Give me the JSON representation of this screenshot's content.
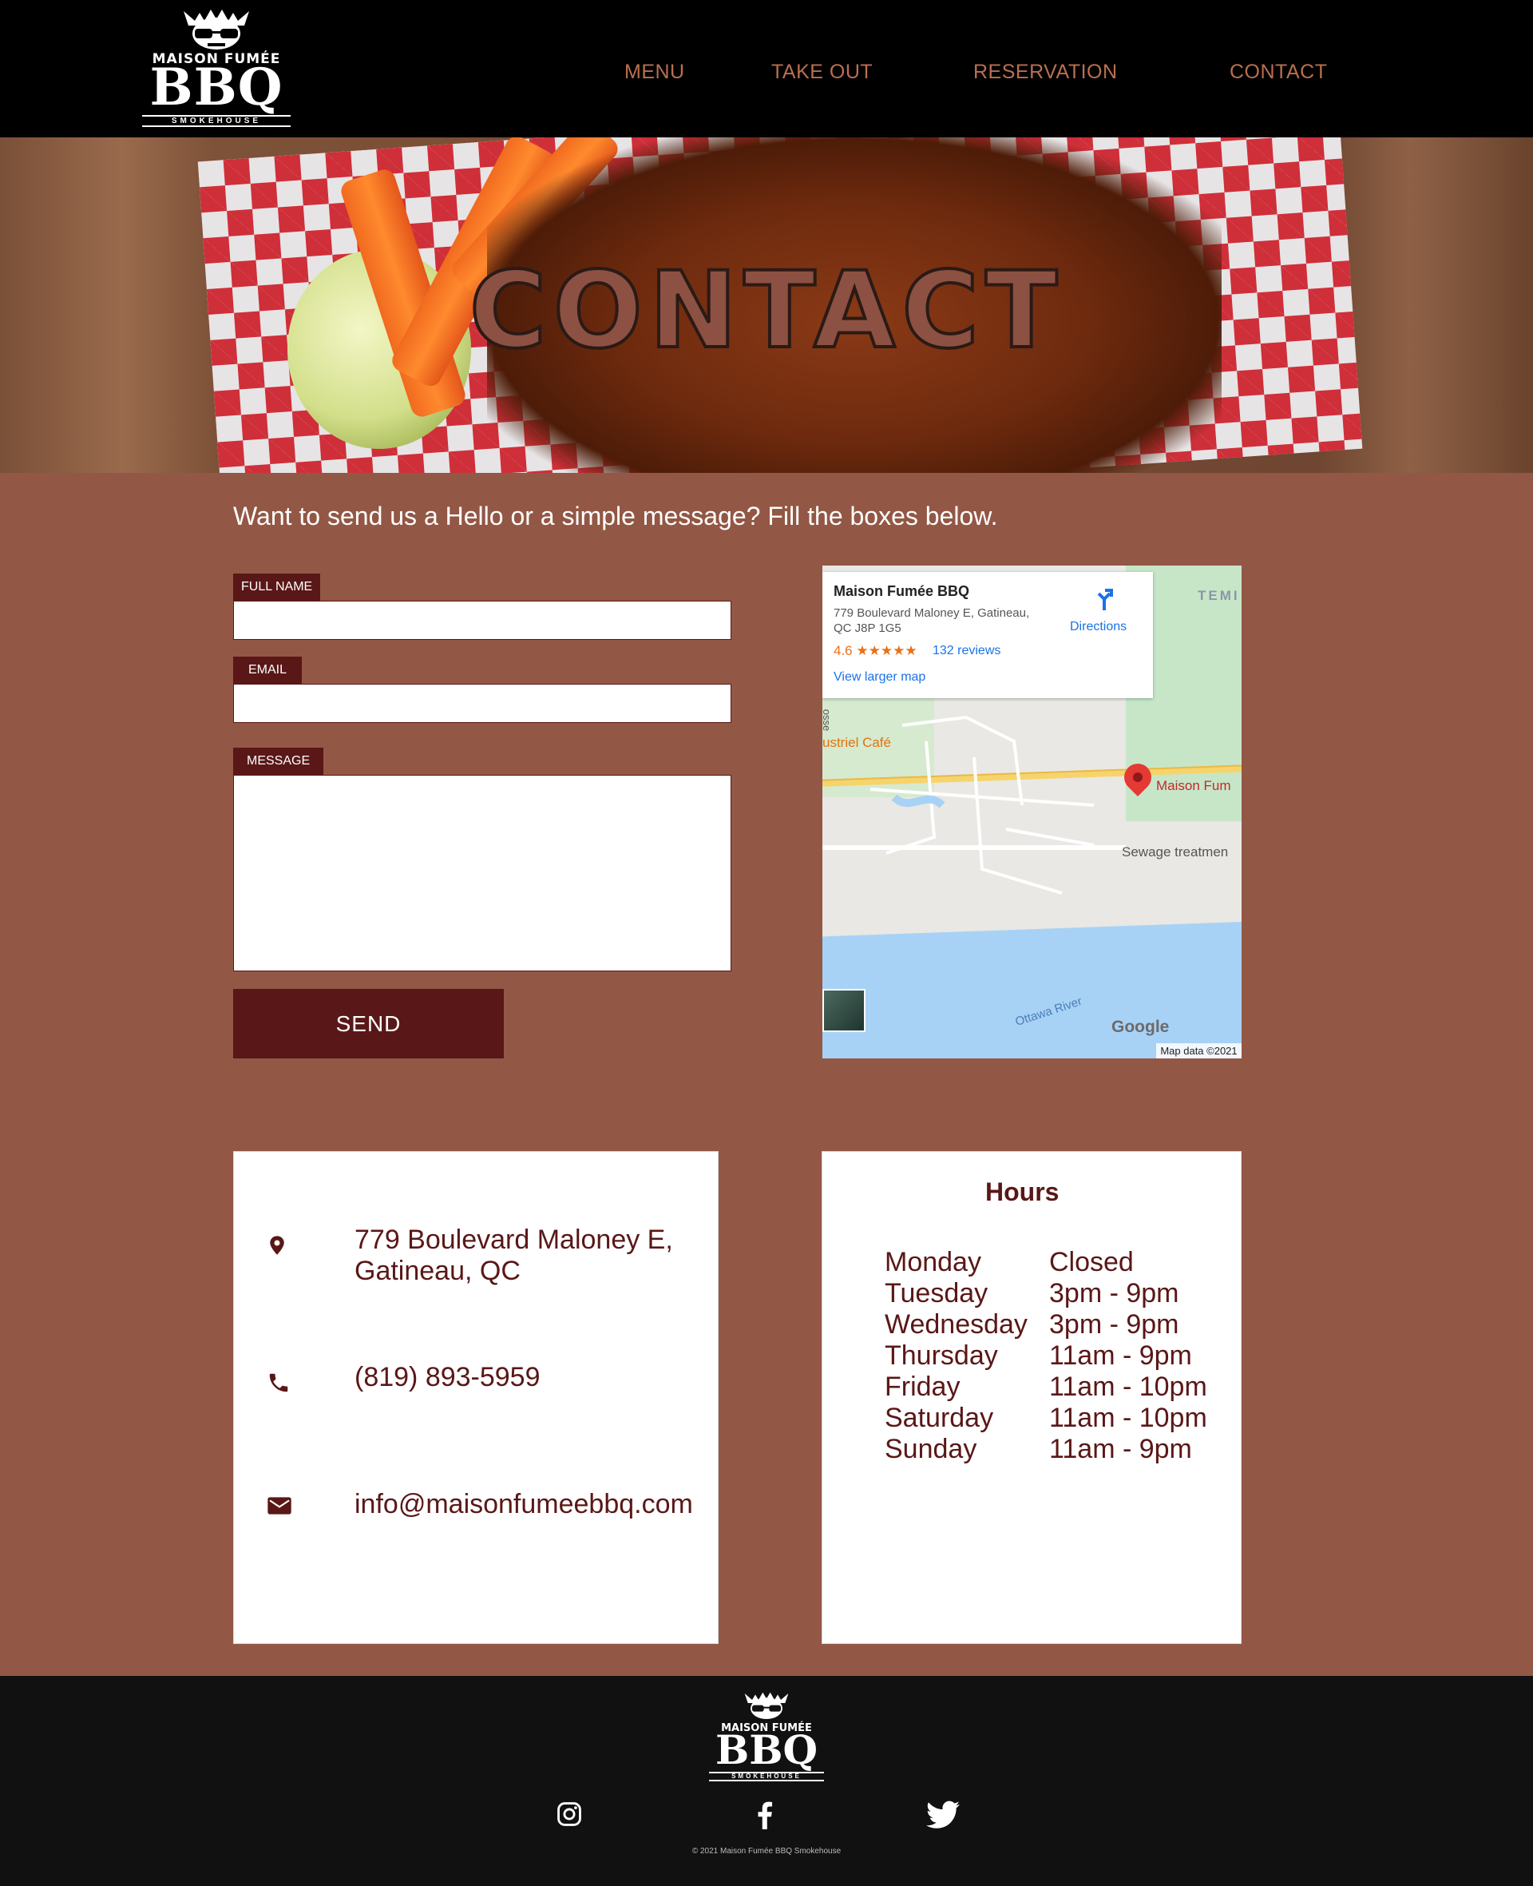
{
  "header": {
    "logo": {
      "line1": "MAISON FUMÉE",
      "line2": "BBQ",
      "line3": "SMOKEHOUSE",
      "icon": "skull-sunglasses-logo"
    },
    "nav": [
      {
        "label": "MENU"
      },
      {
        "label": "TAKE OUT"
      },
      {
        "label": "RESERVATION"
      },
      {
        "label": "CONTACT"
      }
    ]
  },
  "hero": {
    "title": "CONTACT"
  },
  "intro": "Want to send us a Hello or a simple message? Fill the boxes below.",
  "form": {
    "full_name_label": "FULL NAME",
    "full_name_value": "",
    "email_label": "EMAIL",
    "email_value": "",
    "message_label": "MESSAGE",
    "message_value": "",
    "send_label": "SEND"
  },
  "map": {
    "place_name": "Maison Fumée BBQ",
    "address": "779 Boulevard Maloney E, Gatineau, QC J8P 1G5",
    "rating": "4.6 ★★★★★",
    "reviews": "132 reviews",
    "larger_map": "View larger map",
    "directions": "Directions",
    "labels": {
      "temp": "TEMI",
      "cafe": "ustriel Café",
      "marker": "Maison Fum",
      "sewage": "Sewage treatmen",
      "river": "Ottawa River",
      "grosse": "osse"
    },
    "google": "Google",
    "attribution": "Map data ©2021"
  },
  "contact_info": {
    "address_line1": "779 Boulevard Maloney E,",
    "address_line2": "Gatineau, QC",
    "phone": "(819) 893-5959",
    "email": "info@maisonfumeebbq.com"
  },
  "hours": {
    "title": "Hours",
    "rows": [
      {
        "day": "Monday",
        "time": "Closed"
      },
      {
        "day": "Tuesday",
        "time": "3pm - 9pm"
      },
      {
        "day": "Wednesday",
        "time": "3pm - 9pm"
      },
      {
        "day": "Thursday",
        "time": "11am - 9pm"
      },
      {
        "day": "Friday",
        "time": "11am - 10pm"
      },
      {
        "day": "Saturday",
        "time": "11am - 10pm"
      },
      {
        "day": "Sunday",
        "time": "11am - 9pm"
      }
    ]
  },
  "footer": {
    "logo": {
      "line1": "MAISON FUMÉE",
      "line2": "BBQ",
      "line3": "SMOKEHOUSE"
    },
    "social": [
      "instagram-icon",
      "facebook-icon",
      "twitter-icon"
    ],
    "copyright": "© 2021 Maison Fumée BBQ Smokehouse"
  },
  "colors": {
    "page_bg": "#935745",
    "accent": "#5a1717",
    "nav_text": "#b9704f",
    "header_bg": "#000000",
    "footer_bg": "#111111"
  }
}
